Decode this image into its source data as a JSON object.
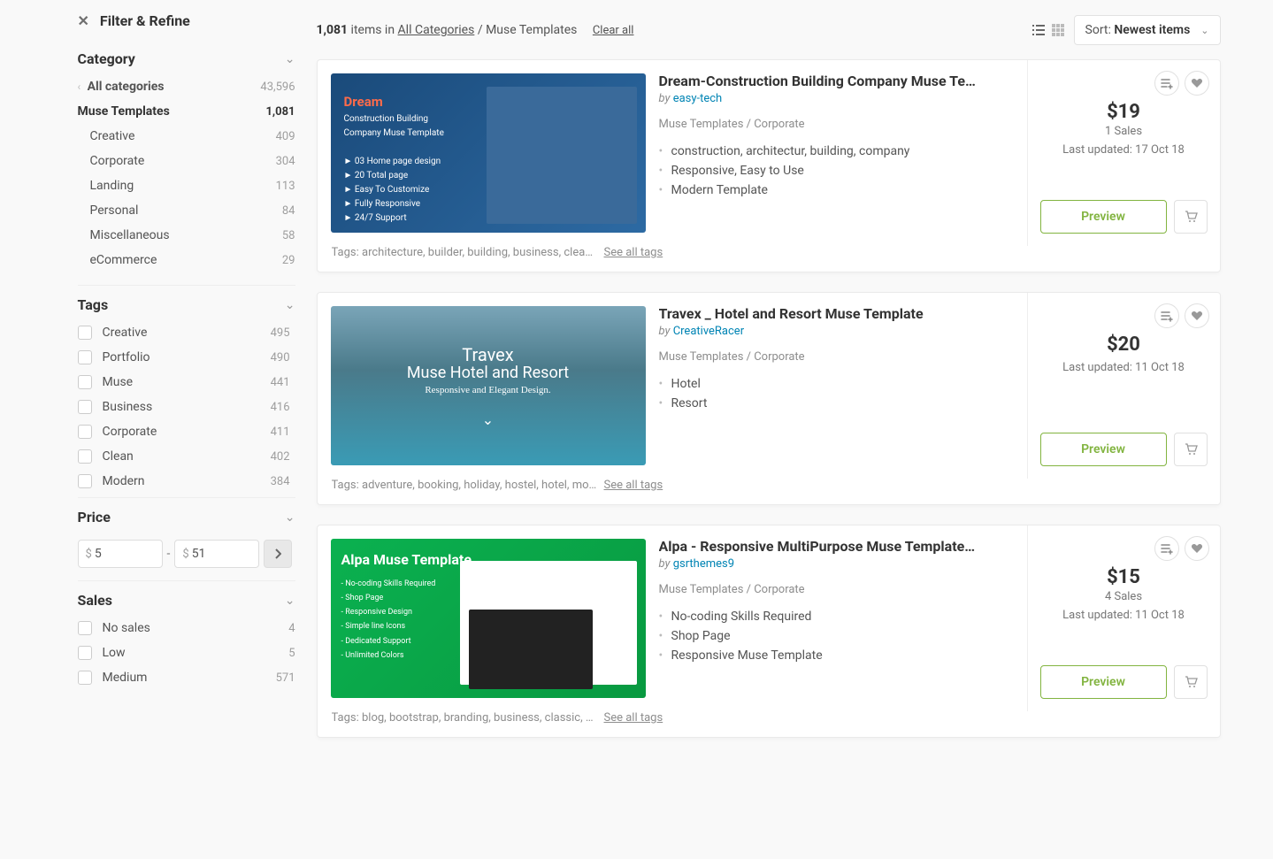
{
  "sidebar": {
    "title": "Filter & Refine",
    "sections": {
      "category": {
        "title": "Category",
        "items": [
          {
            "name": "All categories",
            "count": "43,596",
            "kind": "back"
          },
          {
            "name": "Muse Templates",
            "count": "1,081",
            "kind": "active"
          },
          {
            "name": "Creative",
            "count": "409",
            "kind": "sub"
          },
          {
            "name": "Corporate",
            "count": "304",
            "kind": "sub"
          },
          {
            "name": "Landing",
            "count": "113",
            "kind": "sub"
          },
          {
            "name": "Personal",
            "count": "84",
            "kind": "sub"
          },
          {
            "name": "Miscellaneous",
            "count": "58",
            "kind": "sub"
          },
          {
            "name": "eCommerce",
            "count": "29",
            "kind": "sub"
          }
        ]
      },
      "tags": {
        "title": "Tags",
        "items": [
          {
            "name": "Creative",
            "count": "495"
          },
          {
            "name": "Portfolio",
            "count": "490"
          },
          {
            "name": "Muse",
            "count": "441"
          },
          {
            "name": "Business",
            "count": "416"
          },
          {
            "name": "Corporate",
            "count": "411"
          },
          {
            "name": "Clean",
            "count": "402"
          },
          {
            "name": "Modern",
            "count": "384"
          }
        ]
      },
      "price": {
        "title": "Price",
        "min": "5",
        "max": "51"
      },
      "sales": {
        "title": "Sales",
        "items": [
          {
            "name": "No sales",
            "count": "4"
          },
          {
            "name": "Low",
            "count": "5"
          },
          {
            "name": "Medium",
            "count": "571"
          }
        ]
      }
    }
  },
  "topbar": {
    "count": "1,081",
    "items_in": " items in  ",
    "cat_link": "All Categories",
    "sep": " / ",
    "current": "Muse Templates",
    "clear": "Clear all",
    "sort_label": "Sort: ",
    "sort_value": "Newest items"
  },
  "products": [
    {
      "title": "Dream-Construction Building Company Muse Template",
      "by": "by ",
      "author": "easy-tech",
      "path": "Muse Templates / Corporate",
      "features": [
        "construction, architectur, building, company",
        "Responsive, Easy to Use",
        "Modern Template"
      ],
      "tags": "Tags: architecture, builder, building, business, clean, ...",
      "see": "See all tags",
      "price": "$19",
      "sales": "1 Sales",
      "updated": "Last updated: 17 Oct 18",
      "preview": "Preview",
      "thumb": "t1"
    },
    {
      "title": "Travex _ Hotel and Resort Muse Template",
      "by": "by ",
      "author": "CreativeRacer",
      "path": "Muse Templates / Corporate",
      "features": [
        "Hotel",
        "Resort"
      ],
      "tags": "Tags: adventure, booking, holiday, hostel, hotel, motel...",
      "see": "See all tags",
      "price": "$20",
      "sales": "",
      "updated": "Last updated: 11 Oct 18",
      "preview": "Preview",
      "thumb": "t2"
    },
    {
      "title": "Alpa - Responsive MultiPurpose Muse Template | Busi...",
      "by": "by ",
      "author": "gsrthemes9",
      "path": "Muse Templates / Corporate",
      "features": [
        "No-coding Skills Required",
        "Shop Page",
        "Responsive Muse Template"
      ],
      "tags": "Tags: blog, bootstrap, branding, business, classic, cor...",
      "see": "See all tags",
      "price": "$15",
      "sales": "4 Sales",
      "updated": "Last updated: 11 Oct 18",
      "preview": "Preview",
      "thumb": "t3"
    }
  ]
}
